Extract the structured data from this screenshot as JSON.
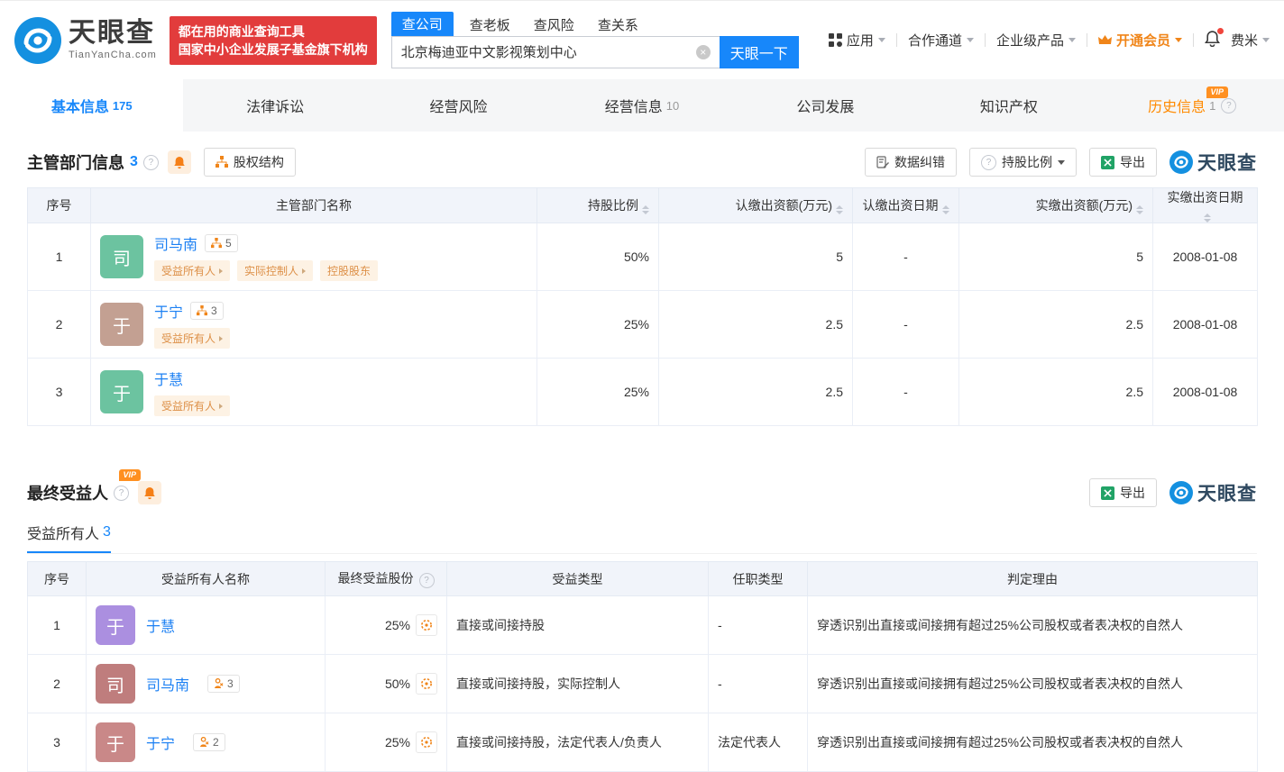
{
  "misc": {
    "help": "?",
    "clear": "×",
    "vip": "VIP"
  },
  "brand": {
    "name": "天眼查",
    "domain": "TianYanCha.com"
  },
  "header": {
    "promo_line1": "都在用的商业查询工具",
    "promo_line2": "国家中小企业发展子基金旗下机构",
    "search": {
      "tabs": [
        {
          "label": "查公司",
          "active": true
        },
        {
          "label": "查老板",
          "active": false
        },
        {
          "label": "查风险",
          "active": false
        },
        {
          "label": "查关系",
          "active": false
        }
      ],
      "value": "北京梅迪亚中文影视策划中心",
      "button": "天眼一下"
    },
    "nav": [
      {
        "label": "应用"
      },
      {
        "label": "合作通道"
      },
      {
        "label": "企业级产品"
      },
      {
        "label": "开通会员"
      },
      {
        "label": "费米"
      }
    ]
  },
  "tabs": [
    {
      "label": "基本信息",
      "count": "175"
    },
    {
      "label": "法律诉讼",
      "count": ""
    },
    {
      "label": "经营风险",
      "count": ""
    },
    {
      "label": "经营信息",
      "count": "10"
    },
    {
      "label": "公司发展",
      "count": ""
    },
    {
      "label": "知识产权",
      "count": ""
    },
    {
      "label": "历史信息",
      "count": "1"
    }
  ],
  "section1": {
    "title": "主管部门信息",
    "count": "3",
    "equity_button": "股权结构",
    "actions": {
      "correct": "数据纠错",
      "ratio": "持股比例",
      "export": "导出"
    },
    "table": {
      "headers": [
        "序号",
        "主管部门名称",
        "持股比例",
        "认缴出资额(万元)",
        "认缴出资日期",
        "实缴出资额(万元)",
        "实缴出资日期"
      ],
      "rows": [
        {
          "index": "1",
          "initial": "司",
          "avatar_color": "#6cc3a0",
          "name": "司马南",
          "badge": "5",
          "tags": [
            "受益所有人",
            "实际控制人",
            "控股股东"
          ],
          "ratio": "50%",
          "subscribed": "5",
          "subscribed_date": "-",
          "paid": "5",
          "paid_date": "2008-01-08"
        },
        {
          "index": "2",
          "initial": "于",
          "avatar_color": "#c3a092",
          "name": "于宁",
          "badge": "3",
          "tags": [
            "受益所有人"
          ],
          "ratio": "25%",
          "subscribed": "2.5",
          "subscribed_date": "-",
          "paid": "2.5",
          "paid_date": "2008-01-08"
        },
        {
          "index": "3",
          "initial": "于",
          "avatar_color": "#6cc3a0",
          "name": "于慧",
          "badge": "",
          "tags": [
            "受益所有人"
          ],
          "ratio": "25%",
          "subscribed": "2.5",
          "subscribed_date": "-",
          "paid": "2.5",
          "paid_date": "2008-01-08"
        }
      ]
    }
  },
  "section2": {
    "title": "最终受益人",
    "subtab": {
      "label": "受益所有人",
      "count": "3"
    },
    "export": "导出",
    "table": {
      "headers": [
        "序号",
        "受益所有人名称",
        "最终受益股份",
        "受益类型",
        "任职类型",
        "判定理由"
      ],
      "rows": [
        {
          "index": "1",
          "initial": "于",
          "avatar_color": "#ab8fe0",
          "name": "于慧",
          "badge": "",
          "share": "25%",
          "benefit_type": "直接或间接持股",
          "position_type": "-",
          "reason": "穿透识别出直接或间接拥有超过25%公司股权或者表决权的自然人"
        },
        {
          "index": "2",
          "initial": "司",
          "avatar_color": "#bf7d7d",
          "name": "司马南",
          "badge": "3",
          "share": "50%",
          "benefit_type": "直接或间接持股，实际控制人",
          "position_type": "-",
          "reason": "穿透识别出直接或间接拥有超过25%公司股权或者表决权的自然人"
        },
        {
          "index": "3",
          "initial": "于",
          "avatar_color": "#c98888",
          "name": "于宁",
          "badge": "2",
          "share": "25%",
          "benefit_type": "直接或间接持股，法定代表人/负责人",
          "position_type": "法定代表人",
          "reason": "穿透识别出直接或间接拥有超过25%公司股权或者表决权的自然人"
        }
      ]
    }
  }
}
